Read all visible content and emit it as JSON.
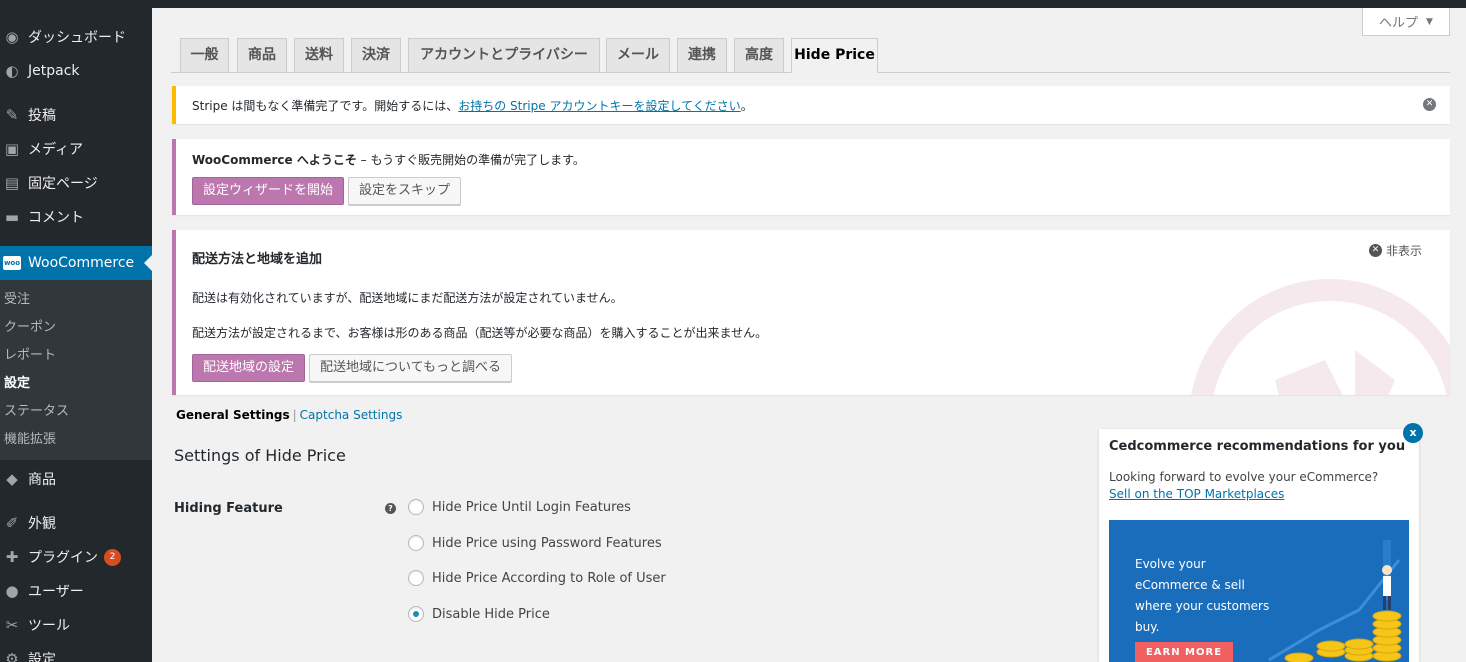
{
  "sidebar": {
    "items": [
      {
        "label": "ダッシュボード",
        "icon": "dashboard-icon",
        "glyph": "◉"
      },
      {
        "label": "Jetpack",
        "icon": "jetpack-icon",
        "glyph": "◐"
      },
      {
        "label": "投稿",
        "icon": "pin-icon",
        "glyph": "✎"
      },
      {
        "label": "メディア",
        "icon": "media-icon",
        "glyph": "▣"
      },
      {
        "label": "固定ページ",
        "icon": "page-icon",
        "glyph": "▤"
      },
      {
        "label": "コメント",
        "icon": "comment-icon",
        "glyph": "▬"
      }
    ],
    "woocommerce": {
      "label": "WooCommerce",
      "logo": "woo"
    },
    "submenu": [
      "受注",
      "クーポン",
      "レポート",
      "設定",
      "ステータス",
      "機能拡張"
    ],
    "bottom_items": [
      {
        "label": "商品",
        "icon": "product-icon",
        "glyph": "◆"
      },
      {
        "label": "外観",
        "icon": "brush-icon",
        "glyph": "✐"
      },
      {
        "label": "プラグイン",
        "icon": "plugin-icon",
        "glyph": "✚",
        "badge": "2"
      },
      {
        "label": "ユーザー",
        "icon": "user-icon",
        "glyph": "●"
      },
      {
        "label": "ツール",
        "icon": "wrench-icon",
        "glyph": "✂"
      },
      {
        "label": "設定",
        "icon": "settings-icon",
        "glyph": "⚙"
      }
    ]
  },
  "help": {
    "label": "ヘルプ",
    "arrow": "▼"
  },
  "tabs": [
    "一般",
    "商品",
    "送料",
    "決済",
    "アカウントとプライバシー",
    "メール",
    "連携",
    "高度",
    "Hide Price"
  ],
  "notices": {
    "stripe": {
      "text": "Stripe は間もなく準備完了です。開始するには、",
      "link": "お持ちの Stripe アカウントキーを設定してください",
      "end": "。"
    },
    "woo": {
      "bold": "WooCommerce へようこそ",
      "text": " – もうすぐ販売開始の準備が完了します。",
      "primary": "設定ウィザードを開始",
      "secondary": "設定をスキップ"
    },
    "shipping": {
      "title": "配送方法と地域を追加",
      "hide": "非表示",
      "p1": "配送は有効化されていますが、配送地域にまだ配送方法が設定されていません。",
      "p2": "配送方法が設定されるまで、お客様は形のある商品（配送等が必要な商品）を購入することが出来ません。",
      "primary": "配送地域の設定",
      "secondary": "配送地域についてもっと調べる"
    }
  },
  "subsub": {
    "current": "General Settings",
    "sep": "|",
    "link": "Captcha Settings"
  },
  "settings": {
    "title": "Settings of Hide Price",
    "field_label": "Hiding Feature",
    "help": "?",
    "options": [
      {
        "label": "Hide Price Until Login Features",
        "checked": false
      },
      {
        "label": "Hide Price using Password Features",
        "checked": false
      },
      {
        "label": "Hide Price According to Role of User",
        "checked": false
      },
      {
        "label": "Disable Hide Price",
        "checked": true
      }
    ]
  },
  "recommend": {
    "title": "Cedcommerce recommendations for you",
    "text": "Looking forward to evolve your eCommerce?",
    "link": "Sell on the TOP Marketplaces",
    "close": "x",
    "banner_lines": [
      "Evolve your",
      "eCommerce & sell",
      "where your customers",
      "buy."
    ],
    "cta": "EARN MORE"
  },
  "colors": {
    "accent": "#0073aa",
    "woo_purple": "#bb77ae",
    "warning": "#ffba00",
    "sidebar": "#23282d"
  }
}
